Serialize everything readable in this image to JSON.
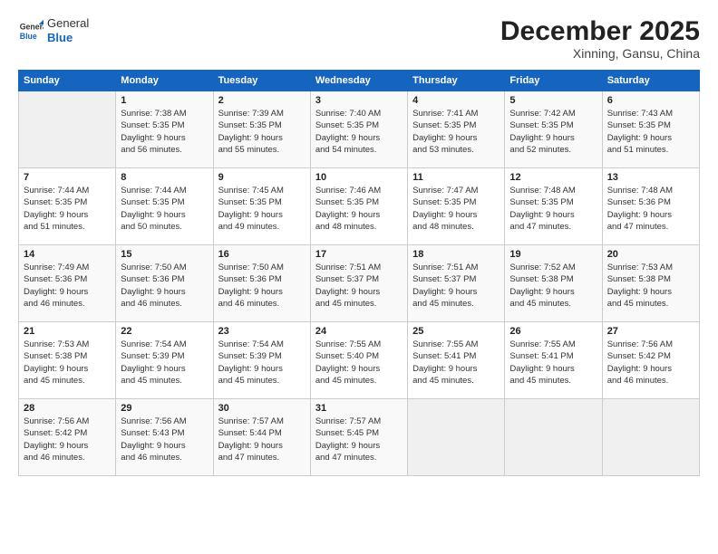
{
  "header": {
    "logo_general": "General",
    "logo_blue": "Blue",
    "title": "December 2025",
    "subtitle": "Xinning, Gansu, China"
  },
  "days_of_week": [
    "Sunday",
    "Monday",
    "Tuesday",
    "Wednesday",
    "Thursday",
    "Friday",
    "Saturday"
  ],
  "weeks": [
    [
      {
        "day": "",
        "info": ""
      },
      {
        "day": "1",
        "info": "Sunrise: 7:38 AM\nSunset: 5:35 PM\nDaylight: 9 hours\nand 56 minutes."
      },
      {
        "day": "2",
        "info": "Sunrise: 7:39 AM\nSunset: 5:35 PM\nDaylight: 9 hours\nand 55 minutes."
      },
      {
        "day": "3",
        "info": "Sunrise: 7:40 AM\nSunset: 5:35 PM\nDaylight: 9 hours\nand 54 minutes."
      },
      {
        "day": "4",
        "info": "Sunrise: 7:41 AM\nSunset: 5:35 PM\nDaylight: 9 hours\nand 53 minutes."
      },
      {
        "day": "5",
        "info": "Sunrise: 7:42 AM\nSunset: 5:35 PM\nDaylight: 9 hours\nand 52 minutes."
      },
      {
        "day": "6",
        "info": "Sunrise: 7:43 AM\nSunset: 5:35 PM\nDaylight: 9 hours\nand 51 minutes."
      }
    ],
    [
      {
        "day": "7",
        "info": "Sunrise: 7:44 AM\nSunset: 5:35 PM\nDaylight: 9 hours\nand 51 minutes."
      },
      {
        "day": "8",
        "info": "Sunrise: 7:44 AM\nSunset: 5:35 PM\nDaylight: 9 hours\nand 50 minutes."
      },
      {
        "day": "9",
        "info": "Sunrise: 7:45 AM\nSunset: 5:35 PM\nDaylight: 9 hours\nand 49 minutes."
      },
      {
        "day": "10",
        "info": "Sunrise: 7:46 AM\nSunset: 5:35 PM\nDaylight: 9 hours\nand 48 minutes."
      },
      {
        "day": "11",
        "info": "Sunrise: 7:47 AM\nSunset: 5:35 PM\nDaylight: 9 hours\nand 48 minutes."
      },
      {
        "day": "12",
        "info": "Sunrise: 7:48 AM\nSunset: 5:35 PM\nDaylight: 9 hours\nand 47 minutes."
      },
      {
        "day": "13",
        "info": "Sunrise: 7:48 AM\nSunset: 5:36 PM\nDaylight: 9 hours\nand 47 minutes."
      }
    ],
    [
      {
        "day": "14",
        "info": "Sunrise: 7:49 AM\nSunset: 5:36 PM\nDaylight: 9 hours\nand 46 minutes."
      },
      {
        "day": "15",
        "info": "Sunrise: 7:50 AM\nSunset: 5:36 PM\nDaylight: 9 hours\nand 46 minutes."
      },
      {
        "day": "16",
        "info": "Sunrise: 7:50 AM\nSunset: 5:36 PM\nDaylight: 9 hours\nand 46 minutes."
      },
      {
        "day": "17",
        "info": "Sunrise: 7:51 AM\nSunset: 5:37 PM\nDaylight: 9 hours\nand 45 minutes."
      },
      {
        "day": "18",
        "info": "Sunrise: 7:51 AM\nSunset: 5:37 PM\nDaylight: 9 hours\nand 45 minutes."
      },
      {
        "day": "19",
        "info": "Sunrise: 7:52 AM\nSunset: 5:38 PM\nDaylight: 9 hours\nand 45 minutes."
      },
      {
        "day": "20",
        "info": "Sunrise: 7:53 AM\nSunset: 5:38 PM\nDaylight: 9 hours\nand 45 minutes."
      }
    ],
    [
      {
        "day": "21",
        "info": "Sunrise: 7:53 AM\nSunset: 5:38 PM\nDaylight: 9 hours\nand 45 minutes."
      },
      {
        "day": "22",
        "info": "Sunrise: 7:54 AM\nSunset: 5:39 PM\nDaylight: 9 hours\nand 45 minutes."
      },
      {
        "day": "23",
        "info": "Sunrise: 7:54 AM\nSunset: 5:39 PM\nDaylight: 9 hours\nand 45 minutes."
      },
      {
        "day": "24",
        "info": "Sunrise: 7:55 AM\nSunset: 5:40 PM\nDaylight: 9 hours\nand 45 minutes."
      },
      {
        "day": "25",
        "info": "Sunrise: 7:55 AM\nSunset: 5:41 PM\nDaylight: 9 hours\nand 45 minutes."
      },
      {
        "day": "26",
        "info": "Sunrise: 7:55 AM\nSunset: 5:41 PM\nDaylight: 9 hours\nand 45 minutes."
      },
      {
        "day": "27",
        "info": "Sunrise: 7:56 AM\nSunset: 5:42 PM\nDaylight: 9 hours\nand 46 minutes."
      }
    ],
    [
      {
        "day": "28",
        "info": "Sunrise: 7:56 AM\nSunset: 5:42 PM\nDaylight: 9 hours\nand 46 minutes."
      },
      {
        "day": "29",
        "info": "Sunrise: 7:56 AM\nSunset: 5:43 PM\nDaylight: 9 hours\nand 46 minutes."
      },
      {
        "day": "30",
        "info": "Sunrise: 7:57 AM\nSunset: 5:44 PM\nDaylight: 9 hours\nand 47 minutes."
      },
      {
        "day": "31",
        "info": "Sunrise: 7:57 AM\nSunset: 5:45 PM\nDaylight: 9 hours\nand 47 minutes."
      },
      {
        "day": "",
        "info": ""
      },
      {
        "day": "",
        "info": ""
      },
      {
        "day": "",
        "info": ""
      }
    ]
  ]
}
